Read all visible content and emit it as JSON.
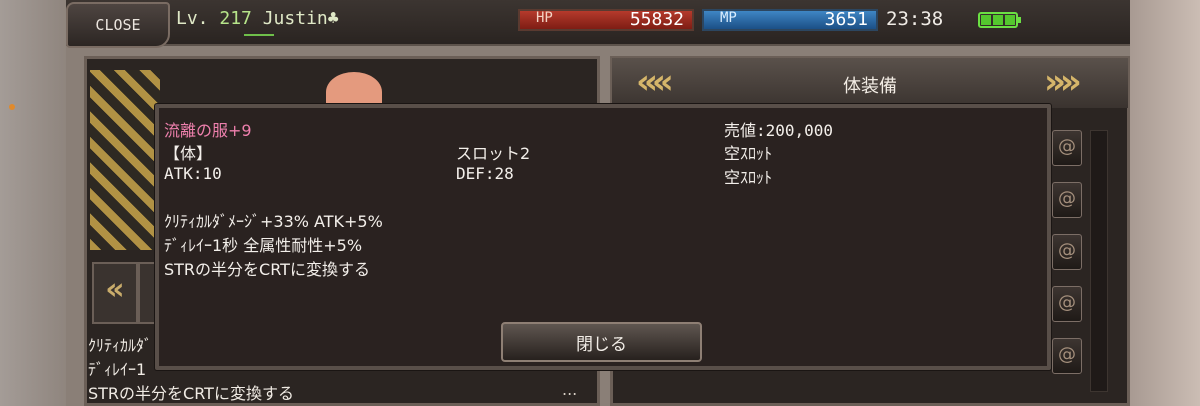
{
  "top_bar": {
    "close_label": "CLOSE",
    "level_prefix": "Lv.",
    "level": "217",
    "player_name": "Justin♣",
    "hp_label": "HP",
    "hp_value": "55832",
    "mp_label": "MP",
    "mp_value": "3651",
    "time": "23:38",
    "battery_icon": "battery-full-icon"
  },
  "equipment_panel": {
    "title": "体装備",
    "prev_icon": "double-chevron-left-icon",
    "next_icon": "double-chevron-right-icon"
  },
  "background_list": {
    "line1": "ｸﾘﾃｨｶﾙﾀﾞ",
    "line2": "ﾃﾞｨﾚｲｰ1",
    "line3": "STRの半分をCRTに変換する",
    "ellipsis": "..."
  },
  "item_detail": {
    "name": "流離の服+9",
    "sell_value": "売値:200,000",
    "slot_type": "【体】",
    "slot_count": "スロット2",
    "empty_slot_1": "空ｽﾛｯﾄ",
    "atk": "ATK:10",
    "def": "DEF:28",
    "empty_slot_2": "空ｽﾛｯﾄ",
    "effect_1": "ｸﾘﾃｨｶﾙﾀﾞﾒｰｼﾞ+33% ATK+5%",
    "effect_2": "ﾃﾞｨﾚｲｰ1秒 全属性耐性+5%",
    "effect_3": "STRの半分をCRTに変換する",
    "close_button": "閉じる"
  },
  "colors": {
    "item_name": "#ee80ad",
    "hp_bar": "#b53a2c",
    "mp_bar": "#3f86c4",
    "level_value": "#b7e58a"
  }
}
